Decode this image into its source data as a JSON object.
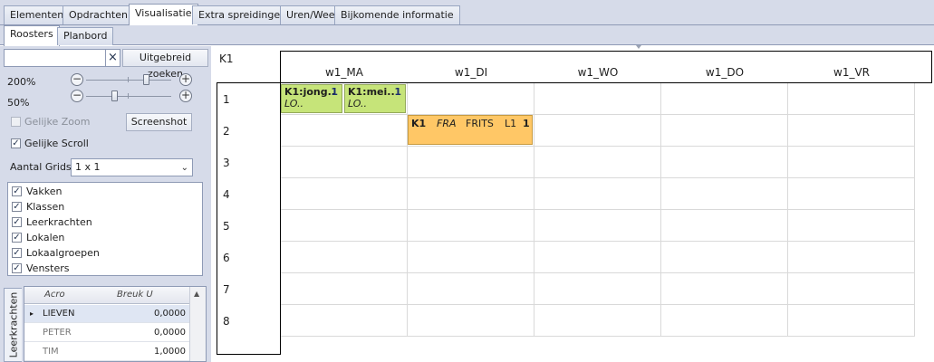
{
  "top_tabs": [
    "Elementen",
    "Opdrachten",
    "Visualisatie",
    "Extra spreidingen",
    "Uren/Week",
    "Bijkomende informatie"
  ],
  "sub_tabs": [
    "Roosters",
    "Planbord"
  ],
  "left_panel": {
    "search_value": "",
    "clear_icon": "×",
    "advanced_search_label": "Uitgebreid zoeken",
    "zoom1_label": "200%",
    "zoom2_label": "50%",
    "zoom1_level_percent": 200,
    "zoom2_level_percent": 50,
    "minus_glyph": "−",
    "plus_glyph": "+",
    "equal_zoom_label": "Gelijke Zoom",
    "equal_zoom_checked": false,
    "screenshot_label": "Screenshot",
    "equal_scroll_label": "Gelijke Scroll",
    "equal_scroll_checked": true,
    "grid_count_label": "Aantal Grids",
    "grid_count_value": "1 x 1",
    "check_glyph": "✓",
    "layers": [
      {
        "label": "Vakken",
        "checked": true
      },
      {
        "label": "Klassen",
        "checked": true
      },
      {
        "label": "Leerkrachten",
        "checked": true
      },
      {
        "label": "Lokalen",
        "checked": true
      },
      {
        "label": "Lokaalgroepen",
        "checked": true
      },
      {
        "label": "Vensters",
        "checked": true
      }
    ],
    "side_tab_label": "Leerkrachten",
    "mini_grid": {
      "headers": [
        "Acro",
        "Breuk U"
      ],
      "rows": [
        {
          "acro": "LIEVEN",
          "value": "0,0000",
          "selected": true
        },
        {
          "acro": "PETER",
          "value": "0,0000",
          "selected": false
        },
        {
          "acro": "TIM",
          "value": "1,0000",
          "selected": false
        }
      ],
      "row_marker": "▸",
      "scroll_up_glyph": "▲"
    }
  },
  "schedule": {
    "title": "K1",
    "days": [
      "w1_MA",
      "w1_DI",
      "w1_WO",
      "w1_DO",
      "w1_VR"
    ],
    "periods": [
      "1",
      "2",
      "3",
      "4",
      "5",
      "6",
      "7",
      "8"
    ],
    "lessons": [
      {
        "line1": "K1:jong..",
        "line2": "LO..",
        "count": "1",
        "color": "#c6e479"
      },
      {
        "line1": "K1:mei..",
        "line2": "LO..",
        "count": "1",
        "color": "#c6e479"
      },
      {
        "class": "K1",
        "subject": "FRA",
        "teacher": "FRITS",
        "room": "L1",
        "count": "1",
        "color": "#ffc766"
      }
    ]
  }
}
